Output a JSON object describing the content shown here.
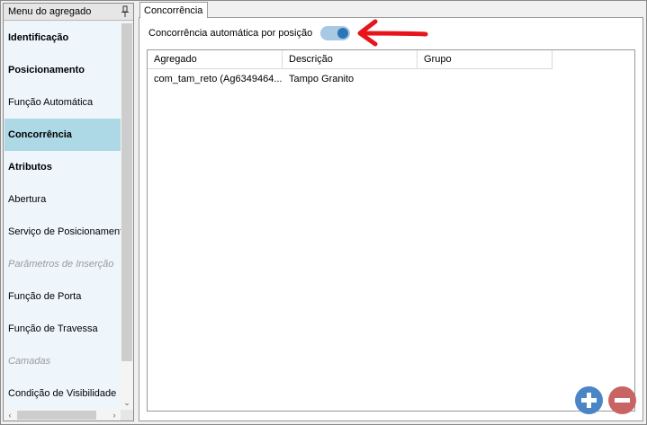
{
  "left_panel": {
    "title": "Menu do agregado",
    "pin_icon": "pin-icon",
    "items": [
      {
        "label": "Identificação",
        "style": "bold"
      },
      {
        "label": "Posicionamento",
        "style": "bold"
      },
      {
        "label": "Função Automática",
        "style": "normal"
      },
      {
        "label": "Concorrência",
        "style": "selected"
      },
      {
        "label": "Atributos",
        "style": "bold"
      },
      {
        "label": "Abertura",
        "style": "normal"
      },
      {
        "label": "Serviço de Posicionamento",
        "style": "normal"
      },
      {
        "label": "Parâmetros de Inserção",
        "style": "disabled"
      },
      {
        "label": "Função de Porta",
        "style": "normal"
      },
      {
        "label": "Função de Travessa",
        "style": "normal"
      },
      {
        "label": "Camadas",
        "style": "disabled"
      },
      {
        "label": "Condição de Visibilidade",
        "style": "normal"
      }
    ],
    "scroll_icons": {
      "down": "chevron-down-icon",
      "left": "chevron-left-icon",
      "right": "chevron-right-icon"
    }
  },
  "tab": {
    "label": "Concorrência"
  },
  "toggle": {
    "label": "Concorrência automática por posição",
    "state": "on"
  },
  "table": {
    "columns": [
      "Agregado",
      "Descrição",
      "Grupo"
    ],
    "rows": [
      [
        "com_tam_reto (Ag6349464...",
        "Tampo Granito",
        ""
      ]
    ]
  },
  "buttons": {
    "add_icon": "plus-circle-icon",
    "remove_icon": "minus-circle-icon"
  },
  "colors": {
    "selected_row": "#add8e6",
    "menu_background": "#eef6fc",
    "toggle_track": "#a9c9e3",
    "toggle_knob": "#2e75b6",
    "annotation_arrow": "#e8141c",
    "add_button": "#4a86c6",
    "remove_button": "#c96464"
  }
}
